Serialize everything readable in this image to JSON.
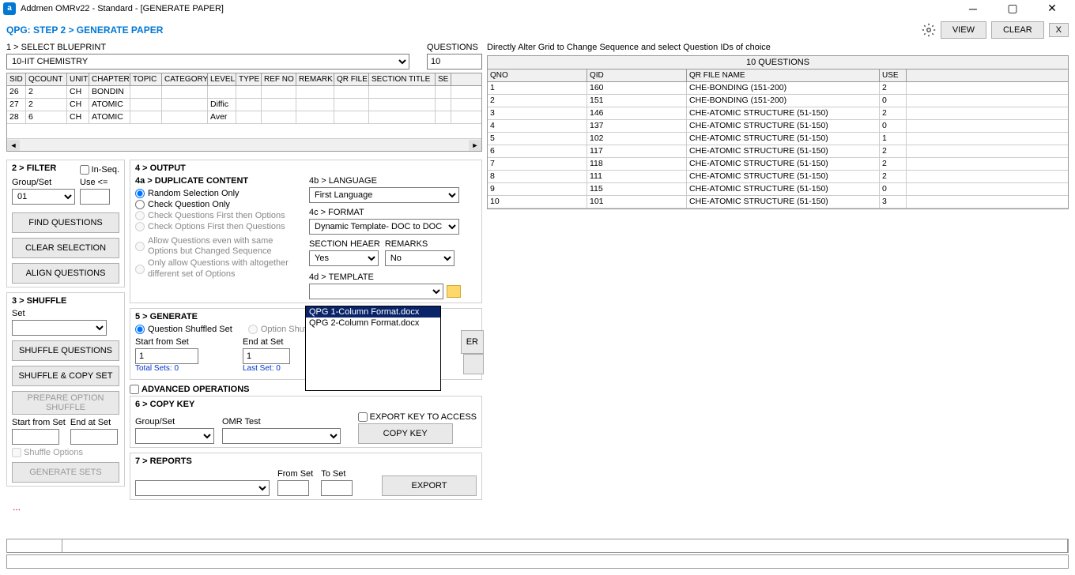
{
  "titlebar": {
    "title": "Addmen OMRv22 - Standard - [GENERATE PAPER]"
  },
  "header": {
    "step": "QPG: STEP 2 > GENERATE PAPER",
    "view": "VIEW",
    "clear": "CLEAR",
    "close": "X"
  },
  "blueprint": {
    "label": "1 > SELECT BLUEPRINT",
    "value": "10-IIT CHEMISTRY",
    "questions_label": "QUESTIONS",
    "questions_value": "10"
  },
  "blueprint_grid": {
    "headers": [
      "SID",
      "QCOUNT",
      "UNIT",
      "CHAPTER",
      "TOPIC",
      "CATEGORY",
      "LEVEL",
      "TYPE",
      "REF NO",
      "REMARK",
      "QR FILE",
      "SECTION TITLE",
      "SE"
    ],
    "widths": [
      24,
      52,
      28,
      52,
      40,
      58,
      36,
      32,
      44,
      48,
      44,
      84,
      20
    ],
    "rows": [
      [
        "26",
        "2",
        "CH",
        "BONDIN",
        "",
        "",
        "",
        "",
        "",
        "",
        "",
        "",
        ""
      ],
      [
        "27",
        "2",
        "CH",
        "ATOMIC",
        "",
        "",
        "Diffic",
        "",
        "",
        "",
        "",
        "",
        ""
      ],
      [
        "28",
        "6",
        "CH",
        "ATOMIC",
        "",
        "",
        "Aver",
        "",
        "",
        "",
        "",
        "",
        ""
      ]
    ]
  },
  "filter": {
    "title": "2 > FILTER",
    "inseq": "In-Seq.",
    "groupset": "Group/Set",
    "groupset_val": "01",
    "use": "Use <=",
    "find": "FIND QUESTIONS",
    "clearsel": "CLEAR SELECTION",
    "align": "ALIGN QUESTIONS"
  },
  "shuffle": {
    "title": "3 > SHUFFLE",
    "set": "Set",
    "shuffle_q": "SHUFFLE QUESTIONS",
    "shuffle_copy": "SHUFFLE & COPY SET",
    "prepare": "PREPARE OPTION SHUFFLE",
    "start_from": "Start from Set",
    "end_at": "End at Set",
    "shuffle_opts": "Shuffle Options",
    "gensets": "GENERATE SETS"
  },
  "output": {
    "title": "4 > OUTPUT",
    "dup_title": "4a > DUPLICATE CONTENT",
    "r1": "Random Selection Only",
    "r2": "Check Question Only",
    "r3": "Check Questions First then Options",
    "r4": "Check Options First then Questions",
    "r5": "Allow Questions even with same Options but Changed Sequence",
    "r6": "Only allow Questions with altogether different set of Options",
    "lang_label": "4b > LANGUAGE",
    "lang_val": "First Language",
    "format_label": "4c > FORMAT",
    "format_val": "Dynamic Template- DOC to DOC",
    "section_header": "SECTION HEAER",
    "section_val": "Yes",
    "remarks": "REMARKS",
    "remarks_val": "No",
    "template_label": "4d > TEMPLATE",
    "template_opts": [
      "QPG 1-Column Format.docx",
      "QPG 2-Column Format.docx"
    ],
    "er_btn": "ER"
  },
  "generate": {
    "title": "5 > GENERATE",
    "qshuffled": "Question Shuffled Set",
    "oshuffled": "Option Shuffle",
    "start": "Start from Set",
    "start_val": "1",
    "total": "Total Sets: 0",
    "end": "End at Set",
    "end_val": "1",
    "last": "Last Set: 0"
  },
  "advanced": {
    "title": "ADVANCED OPERATIONS"
  },
  "copykey": {
    "title": "6 > COPY KEY",
    "groupset": "Group/Set",
    "omr": "OMR Test",
    "export": "EXPORT KEY TO ACCESS",
    "copy": "COPY KEY"
  },
  "reports": {
    "title": "7 > REPORTS",
    "from": "From Set",
    "to": "To Set",
    "export": "EXPORT"
  },
  "right_panel": {
    "hint": "Directly Alter Grid to Change Sequence and select Question IDs of choice",
    "grid_title": "10 QUESTIONS",
    "headers": [
      "QNO",
      "QID",
      "QR FILE NAME",
      "USE"
    ],
    "widths": [
      126,
      126,
      244,
      34
    ],
    "rows": [
      [
        "1",
        "160",
        "CHE-BONDING (151-200)",
        "2"
      ],
      [
        "2",
        "151",
        "CHE-BONDING (151-200)",
        "0"
      ],
      [
        "3",
        "146",
        "CHE-ATOMIC STRUCTURE (51-150)",
        "2"
      ],
      [
        "4",
        "137",
        "CHE-ATOMIC STRUCTURE (51-150)",
        "0"
      ],
      [
        "5",
        "102",
        "CHE-ATOMIC STRUCTURE (51-150)",
        "1"
      ],
      [
        "6",
        "117",
        "CHE-ATOMIC STRUCTURE (51-150)",
        "2"
      ],
      [
        "7",
        "118",
        "CHE-ATOMIC STRUCTURE (51-150)",
        "2"
      ],
      [
        "8",
        "111",
        "CHE-ATOMIC STRUCTURE (51-150)",
        "2"
      ],
      [
        "9",
        "115",
        "CHE-ATOMIC STRUCTURE (51-150)",
        "0"
      ],
      [
        "10",
        "101",
        "CHE-ATOMIC STRUCTURE (51-150)",
        "3"
      ]
    ]
  }
}
